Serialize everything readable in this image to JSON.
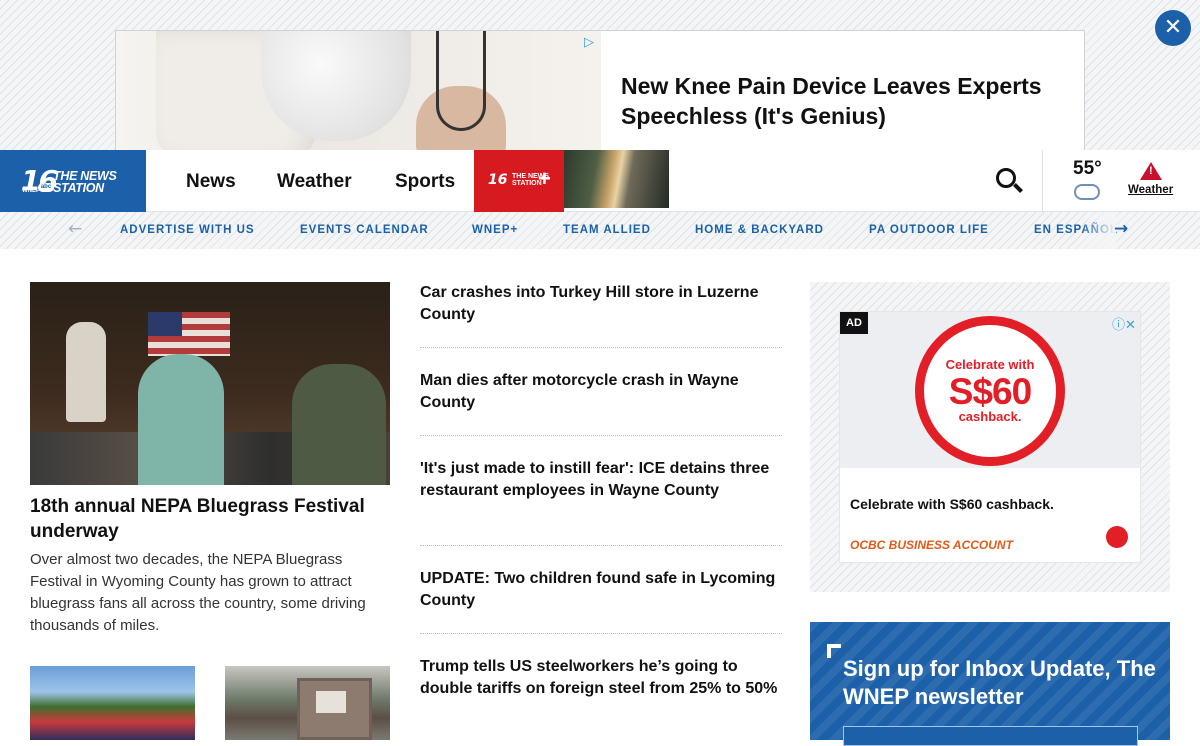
{
  "top_ad": {
    "title": "New Knee Pain Device Leaves Experts Speechless (It's Genius)",
    "info_icon": "adchoices-icon",
    "close_label": "✕"
  },
  "nav": {
    "logo": {
      "number": "16",
      "name_line1": "THE NEWS",
      "name_line2": "STATION",
      "abc": "abc",
      "call": "WNEP"
    },
    "links": [
      "News",
      "Weather",
      "Sports"
    ],
    "brand": {
      "number": "16",
      "line1": "THE NEWS",
      "line2": "STATION",
      "plus": "+"
    },
    "search_icon": "search-icon",
    "weather": {
      "temp": "55°",
      "icon": "cloud-rain-icon",
      "alert_icon": "warning-icon",
      "label": "Weather"
    }
  },
  "subnav": {
    "prev_label": "←",
    "next_label": "→",
    "items": [
      "ADVERTISE WITH US",
      "EVENTS CALENDAR",
      "WNEP+",
      "TEAM ALLIED",
      "HOME & BACKYARD",
      "PA OUTDOOR LIFE",
      "EN ESPAÑOL"
    ]
  },
  "lead": {
    "title": "18th annual NEPA Bluegrass Festival underway",
    "description": "Over almost two decades, the NEPA Bluegrass Festival in Wyoming County has grown to attract bluegrass fans all across the country, some driving thousands of miles."
  },
  "headlines": [
    "Car crashes into Turkey Hill store in Luzerne County",
    "Man dies after motorcycle crash in Wayne County",
    "'It's just made to instill fear': ICE detains three restaurant employees in Wayne County",
    "UPDATE: Two children found safe in Lycoming County",
    "Trump tells US steelworkers he’s going to double tariffs on foreign steel from 25% to 50%"
  ],
  "side_ad": {
    "label": "AD",
    "icons": "ⓘ✕",
    "ring_line1": "Celebrate with",
    "ring_line2": "S$60",
    "ring_line3": "cashback.",
    "caption": "Celebrate with S$60 cashback.",
    "brand": "OCBC BUSINESS ACCOUNT"
  },
  "newsletter": {
    "title": "Sign up for Inbox Update, The WNEP newsletter"
  },
  "colors": {
    "brand_blue": "#1b60a8",
    "brand_red": "#d71920",
    "ad_red": "#e21f26"
  }
}
